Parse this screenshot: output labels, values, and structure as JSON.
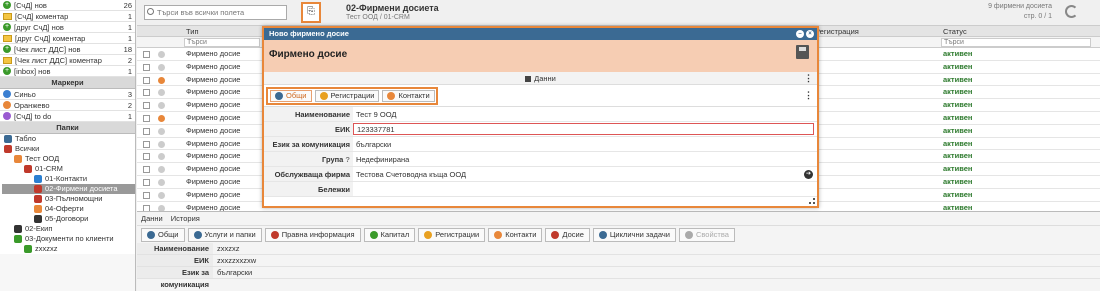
{
  "sidebar": {
    "inbox_items": [
      {
        "label": "[СчД] нов",
        "count": "26",
        "color": "#3a9a2a",
        "kind": "plus"
      },
      {
        "label": "[СчД] коментар",
        "count": "1",
        "color": "#f4c542",
        "kind": "env"
      },
      {
        "label": "[друг СчД] нов",
        "count": "1",
        "color": "#3a9a2a",
        "kind": "plus"
      },
      {
        "label": "[друг СчД] коментар",
        "count": "1",
        "color": "#f4c542",
        "kind": "env"
      },
      {
        "label": "[Чек лист ДДС] нов",
        "count": "18",
        "color": "#3a9a2a",
        "kind": "plus"
      },
      {
        "label": "[Чек лист ДДС] коментар",
        "count": "2",
        "color": "#f4c542",
        "kind": "env"
      },
      {
        "label": "[inbox] нов",
        "count": "1",
        "color": "#3a9a2a",
        "kind": "plus"
      }
    ],
    "markers_title": "Маркери",
    "markers": [
      {
        "label": "Синьо",
        "count": "3",
        "color": "#3b7fd1"
      },
      {
        "label": "Оранжево",
        "count": "2",
        "color": "#e8873a"
      },
      {
        "label": "[СчД] to do",
        "count": "1",
        "color": "#9a5bd1"
      }
    ],
    "folders_title": "Папки",
    "tree": [
      {
        "label": "Табло",
        "indent": 0,
        "color": "#3b6a93"
      },
      {
        "label": "Всички",
        "indent": 0,
        "color": "#c0392b"
      },
      {
        "label": "Тест ООД",
        "indent": 1,
        "color": "#e8873a"
      },
      {
        "label": "01-CRM",
        "indent": 2,
        "color": "#c0392b"
      },
      {
        "label": "01-Контакти",
        "indent": 3,
        "color": "#2a7fd1"
      },
      {
        "label": "02-Фирмени досиета",
        "indent": 3,
        "color": "#c0392b",
        "selected": true
      },
      {
        "label": "03-Пълномощни",
        "indent": 3,
        "color": "#c0392b"
      },
      {
        "label": "04-Оферти",
        "indent": 3,
        "color": "#e8873a"
      },
      {
        "label": "05-Договори",
        "indent": 3,
        "color": "#333"
      },
      {
        "label": "02-Екип",
        "indent": 1,
        "color": "#333"
      },
      {
        "label": "03-Документи по клиенти",
        "indent": 1,
        "color": "#3a9a2a"
      },
      {
        "label": "zxxzxz",
        "indent": 2,
        "color": "#3a9a2a"
      }
    ]
  },
  "topbar": {
    "search_placeholder": "Търси във всички полета",
    "title": "02-Фирмени досиета",
    "subtitle": "Тест ООД / 01-CRM",
    "count": "9 фирмени досиета",
    "pages": "стр. 0 / 1"
  },
  "grid": {
    "col_type": "Тип",
    "col_registration": "Регистрация",
    "col_status": "Статус",
    "filter_placeholder": "Търси",
    "rows": [
      {
        "type": "Фирмено досие",
        "status": "активен",
        "dot": ""
      },
      {
        "type": "Фирмено досие",
        "status": "активен",
        "dot": ""
      },
      {
        "type": "Фирмено досие",
        "status": "активен",
        "dot": "#e8873a"
      },
      {
        "type": "Фирмено досие",
        "status": "активен",
        "dot": ""
      },
      {
        "type": "Фирмено досие",
        "status": "активен",
        "dot": ""
      },
      {
        "type": "Фирмено досие",
        "status": "активен",
        "dot": "#e8873a"
      },
      {
        "type": "Фирмено досие",
        "status": "активен",
        "dot": ""
      },
      {
        "type": "Фирмено досие",
        "status": "активен",
        "dot": ""
      },
      {
        "type": "Фирмено досие",
        "status": "активен",
        "dot": ""
      },
      {
        "type": "Фирмено досие",
        "status": "активен",
        "dot": ""
      },
      {
        "type": "Фирмено досие",
        "status": "активен",
        "dot": ""
      },
      {
        "type": "Фирмено досие",
        "status": "активен",
        "dot": ""
      },
      {
        "type": "Фирмено досие",
        "status": "активен",
        "dot": ""
      }
    ]
  },
  "detail": {
    "tab_data": "Данни",
    "tab_history": "История",
    "buttons": [
      {
        "label": "Общи",
        "color": "#3b6a93"
      },
      {
        "label": "Услуги и папки",
        "color": "#3b6a93"
      },
      {
        "label": "Правна информация",
        "color": "#c0392b"
      },
      {
        "label": "Капитал",
        "color": "#3a9a2a"
      },
      {
        "label": "Регистрации",
        "color": "#e8a020"
      },
      {
        "label": "Контакти",
        "color": "#e8873a"
      },
      {
        "label": "Досие",
        "color": "#c0392b"
      },
      {
        "label": "Циклични задачи",
        "color": "#3b6a93"
      },
      {
        "label": "Свойства",
        "color": "#aaa",
        "disabled": true
      }
    ],
    "fields": [
      {
        "label": "Наименование",
        "value": "zxxzxz"
      },
      {
        "label": "ЕИК",
        "value": "zxxzzxxzxw"
      },
      {
        "label": "Език за комуникация",
        "value": "български"
      }
    ]
  },
  "modal": {
    "window_title": "Ново фирмено досие",
    "header": "Фирмено досие",
    "section": "Данни",
    "tabs": [
      {
        "label": "Общи",
        "color": "#3b6a93",
        "active": true
      },
      {
        "label": "Регистрации",
        "color": "#e8a020"
      },
      {
        "label": "Контакти",
        "color": "#e8873a"
      }
    ],
    "fields": [
      {
        "label": "Наименование",
        "value": "Тест 9 ООД"
      },
      {
        "label": "ЕИК",
        "value": "123337781",
        "error": true
      },
      {
        "label": "Език за комуникация",
        "value": "български"
      },
      {
        "label": "Група",
        "value": "Недефинирана",
        "help": true
      },
      {
        "label": "Обслужваща фирма",
        "value": "Тестова Счетоводна къща ООД",
        "go": true
      },
      {
        "label": "Бележки",
        "value": ""
      }
    ]
  }
}
